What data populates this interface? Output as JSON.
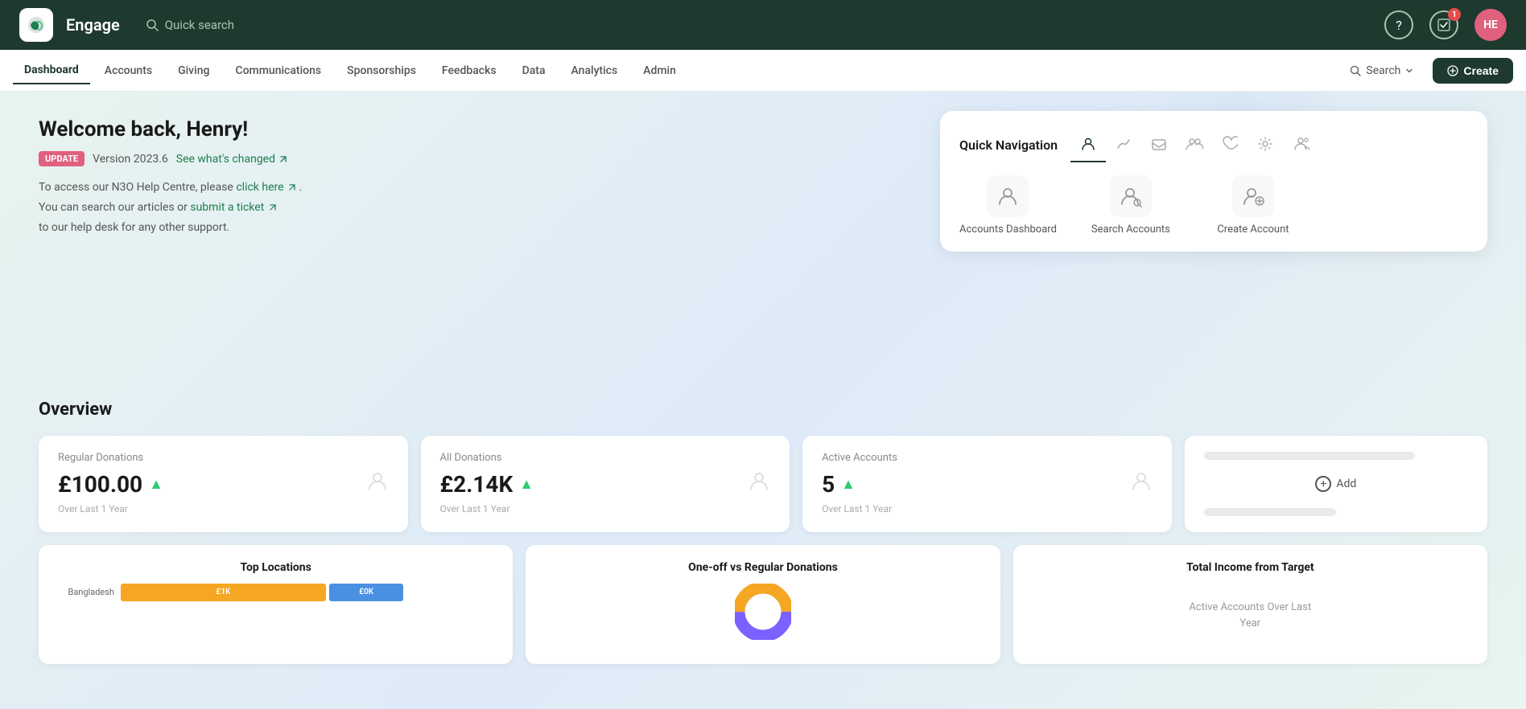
{
  "topbar": {
    "logo_alt": "Engage logo",
    "brand_name": "Engage",
    "search_placeholder": "Quick search",
    "help_icon": "?",
    "task_badge": "1",
    "avatar_initials": "HE",
    "task_icon": "✓"
  },
  "navbar": {
    "items": [
      {
        "label": "Dashboard",
        "active": true
      },
      {
        "label": "Accounts",
        "active": false
      },
      {
        "label": "Giving",
        "active": false
      },
      {
        "label": "Communications",
        "active": false
      },
      {
        "label": "Sponsorships",
        "active": false
      },
      {
        "label": "Feedbacks",
        "active": false
      },
      {
        "label": "Data",
        "active": false
      },
      {
        "label": "Analytics",
        "active": false
      },
      {
        "label": "Admin",
        "active": false
      }
    ],
    "search_label": "Search",
    "create_label": "Create"
  },
  "welcome": {
    "title": "Welcome back, Henry!",
    "badge": "UPDATE",
    "version": "Version 2023.6",
    "see_changes": "See what's changed",
    "help_line1": "To access our N3O Help Centre, please",
    "click_here": "click here",
    "help_line2": "You can search our articles or",
    "submit_ticket": "submit a ticket",
    "help_line3": "to our help desk for any other support."
  },
  "quick_nav": {
    "title": "Quick Navigation",
    "tabs": [
      {
        "icon": "👤",
        "active": true
      },
      {
        "icon": "📊",
        "active": false
      },
      {
        "icon": "📥",
        "active": false
      },
      {
        "icon": "👥",
        "active": false
      },
      {
        "icon": "♡",
        "active": false
      },
      {
        "icon": "⚙",
        "active": false
      },
      {
        "icon": "👤",
        "active": false
      }
    ],
    "items": [
      {
        "label": "Accounts Dashboard",
        "icon": "👤"
      },
      {
        "label": "Search Accounts",
        "icon": "👤"
      },
      {
        "label": "Create Account",
        "icon": "👤"
      }
    ]
  },
  "overview": {
    "title": "Overview",
    "cards": [
      {
        "label": "Regular Donations",
        "value": "£100.00",
        "sublabel": "Over Last 1 Year",
        "trend": "up"
      },
      {
        "label": "All Donations",
        "value": "£2.14K",
        "sublabel": "Over Last 1 Year",
        "trend": "up"
      },
      {
        "label": "Active Accounts",
        "value": "5",
        "sublabel": "Over Last 1 Year",
        "trend": "up"
      }
    ],
    "add_label": "Add"
  },
  "charts": [
    {
      "title": "Top Locations",
      "bars": [
        {
          "label": "Bangladesh",
          "orange_val": "£1K",
          "orange_pct": 65,
          "blue_val": "£0K",
          "blue_pct": 20
        }
      ]
    },
    {
      "title": "One-off vs Regular Donations"
    },
    {
      "title": "Total Income from Target"
    }
  ],
  "active_accounts_chart": {
    "label": "Active Accounts Over Last Year"
  }
}
